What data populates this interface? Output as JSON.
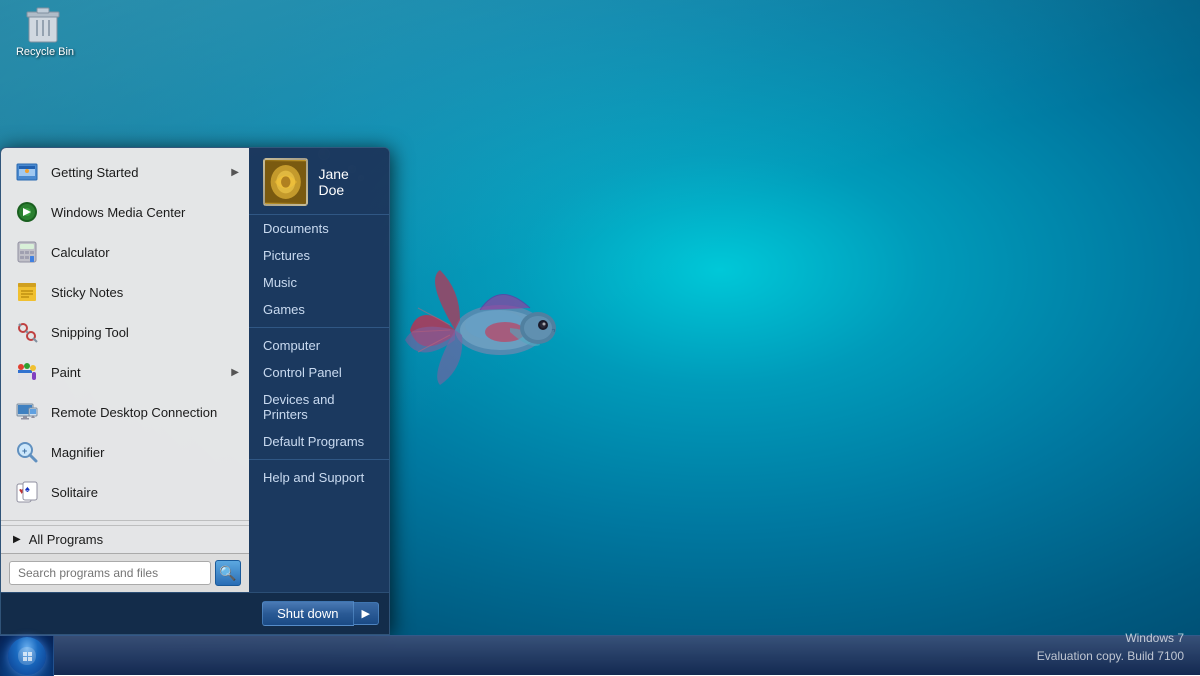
{
  "desktop": {
    "watermark_line1": "Windows 7",
    "watermark_line2": "Evaluation copy. Build 7100"
  },
  "recycle_bin": {
    "label": "Recycle Bin"
  },
  "start_menu": {
    "left_items": [
      {
        "id": "getting-started",
        "label": "Getting Started",
        "has_arrow": true,
        "icon": "📋"
      },
      {
        "id": "windows-media-center",
        "label": "Windows Media Center",
        "has_arrow": false,
        "icon": "🎬"
      },
      {
        "id": "calculator",
        "label": "Calculator",
        "has_arrow": false,
        "icon": "🧮"
      },
      {
        "id": "sticky-notes",
        "label": "Sticky Notes",
        "has_arrow": false,
        "icon": "📝"
      },
      {
        "id": "snipping-tool",
        "label": "Snipping Tool",
        "has_arrow": false,
        "icon": "✂️"
      },
      {
        "id": "paint",
        "label": "Paint",
        "has_arrow": true,
        "icon": "🎨"
      },
      {
        "id": "remote-desktop",
        "label": "Remote Desktop Connection",
        "has_arrow": false,
        "icon": "🖥️"
      },
      {
        "id": "magnifier",
        "label": "Magnifier",
        "has_arrow": false,
        "icon": "🔍"
      },
      {
        "id": "solitaire",
        "label": "Solitaire",
        "has_arrow": false,
        "icon": "🃏"
      }
    ],
    "all_programs_label": "All Programs",
    "search_placeholder": "Search programs and files",
    "right_items": [
      {
        "id": "documents",
        "label": "Documents"
      },
      {
        "id": "pictures",
        "label": "Pictures"
      },
      {
        "id": "music",
        "label": "Music"
      },
      {
        "id": "games",
        "label": "Games"
      },
      {
        "id": "computer",
        "label": "Computer"
      },
      {
        "id": "control-panel",
        "label": "Control Panel"
      },
      {
        "id": "devices-printers",
        "label": "Devices and Printers"
      },
      {
        "id": "default-programs",
        "label": "Default Programs"
      },
      {
        "id": "help-support",
        "label": "Help and Support"
      }
    ],
    "username": "Jane Doe",
    "shutdown_label": "Shut down"
  }
}
